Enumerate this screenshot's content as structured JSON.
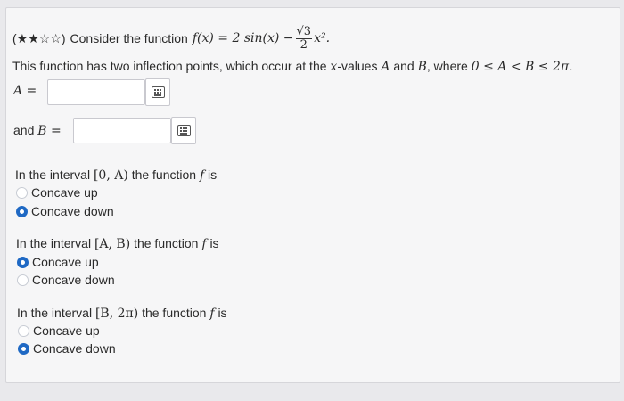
{
  "question": {
    "stars": "(★★☆☆)",
    "intro": "Consider the function",
    "fn_lhs": "f(x) = 2 sin(x) −",
    "frac_num": "√3",
    "frac_den": "2",
    "fn_tail": "x².",
    "line2_a": "This function has two inflection points, which occur at the",
    "line2_xvar": "x",
    "line2_b": "-values",
    "line2_A": "A",
    "line2_and": "and",
    "line2_B": "B",
    "line2_c": ", where",
    "line2_ineq": "0 ≤ A < B ≤ 2π."
  },
  "answers": {
    "A_label": "A =",
    "A_value": "",
    "B_prefix": "and",
    "B_label": "B =",
    "B_value": ""
  },
  "intervals": [
    {
      "prefix": "In the interval",
      "interval": "[0, A)",
      "suffix": "the function",
      "fvar": "f",
      "is": "is",
      "options": [
        {
          "label": "Concave up",
          "selected": false
        },
        {
          "label": "Concave down",
          "selected": true
        }
      ]
    },
    {
      "prefix": "In the interval",
      "interval": "[A, B)",
      "suffix": "the function",
      "fvar": "f",
      "is": "is",
      "options": [
        {
          "label": "Concave up",
          "selected": true
        },
        {
          "label": "Concave down",
          "selected": false
        }
      ]
    },
    {
      "prefix": "In the interval",
      "interval": "[B, 2π)",
      "suffix": "the function",
      "fvar": "f",
      "is": "is",
      "options": [
        {
          "label": "Concave up",
          "selected": false
        },
        {
          "label": "Concave down",
          "selected": true
        }
      ]
    }
  ],
  "colors": {
    "radio_selected": "#1f69c4",
    "panel_bg": "#f6f6f7"
  },
  "icons": {
    "keypad": "keypad-icon"
  }
}
